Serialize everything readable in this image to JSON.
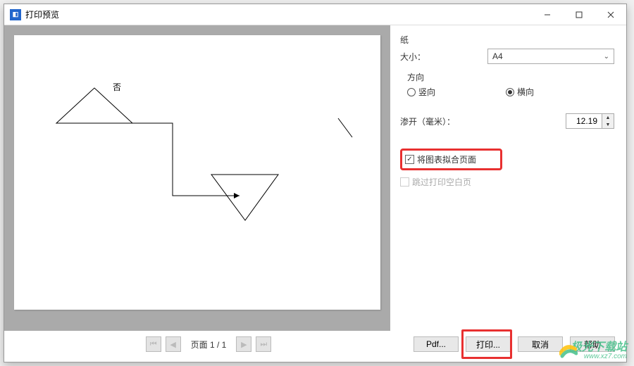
{
  "window": {
    "title": "打印预览"
  },
  "paper": {
    "section_label": "纸",
    "size_label": "大小：",
    "size_value": "A4",
    "orientation_label": "方向",
    "portrait_label": "竖向",
    "landscape_label": "横向",
    "orientation_value": "landscape"
  },
  "bleed": {
    "label": "渗开（毫米）：",
    "value": "12.19"
  },
  "options": {
    "fit_to_page_label": "将图表拟合页面",
    "fit_to_page_checked": true,
    "skip_blank_pages_label": "跳过打印空白页",
    "skip_blank_pages_checked": false
  },
  "nav": {
    "page_label": "页面 1 / 1"
  },
  "buttons": {
    "pdf": "Pdf...",
    "print": "打印...",
    "cancel": "取消",
    "help": "帮助"
  },
  "drawing": {
    "label_above_triangle": "否"
  },
  "watermark": {
    "brand": "极光下载站",
    "url": "www.xz7.com"
  }
}
